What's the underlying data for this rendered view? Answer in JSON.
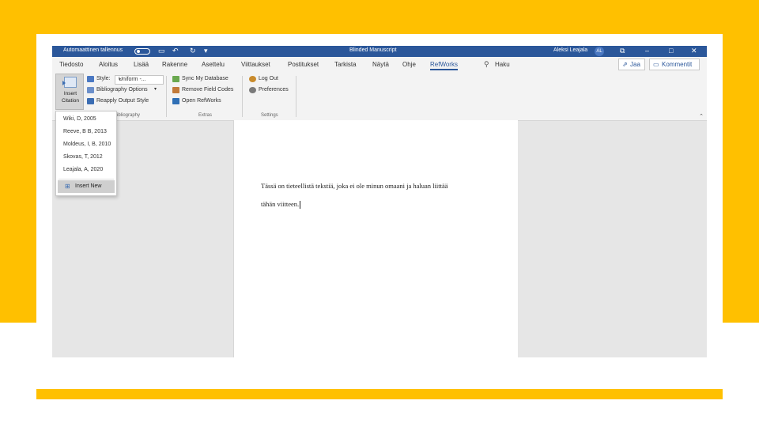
{
  "colors": {
    "slide_accent": "#FFC000",
    "title_bar": "#2b579a",
    "refworks_accent": "#2b579a"
  },
  "title_bar": {
    "autosave_label": "Automaattinen tallennus",
    "document_title": "Blinded Manuscript",
    "user_name": "Aleksi Leajala",
    "user_initials": "AL"
  },
  "tabs": [
    "Tiedosto",
    "Aloitus",
    "Lisää",
    "Rakenne",
    "Asettelu",
    "Viittaukset",
    "Postitukset",
    "Tarkista",
    "Näytä",
    "Ohje",
    "RefWorks"
  ],
  "active_tab": "RefWorks",
  "search": {
    "label": "Haku"
  },
  "share_button": "Jaa",
  "comments_button": "Kommentit",
  "ribbon": {
    "insert_citation_line1": "Insert",
    "insert_citation_line2": "Citation",
    "style_label": "Style:",
    "style_value": "Uniform -...",
    "bibliography_options": "Bibliography Options",
    "reapply_output_style": "Reapply Output Style",
    "group_bibliography": "Bibliography",
    "sync_my_database": "Sync My Database",
    "remove_field_codes": "Remove Field Codes",
    "open_refworks": "Open RefWorks",
    "group_extras": "Extras",
    "log_out": "Log Out",
    "preferences": "Preferences",
    "group_settings": "Settings"
  },
  "citation_dropdown": {
    "items": [
      "Wiki, D, 2005",
      "Reeve, B B, 2013",
      "Moldeus, I, B, 2010",
      "Skovas, T, 2012",
      "Leajala, A, 2020"
    ],
    "insert_new": "Insert New"
  },
  "document": {
    "line1": "Tässä on tieteellistä tekstiä, joka ei ole minun omaani ja haluan liittää",
    "line2": "tähän viitteen."
  }
}
